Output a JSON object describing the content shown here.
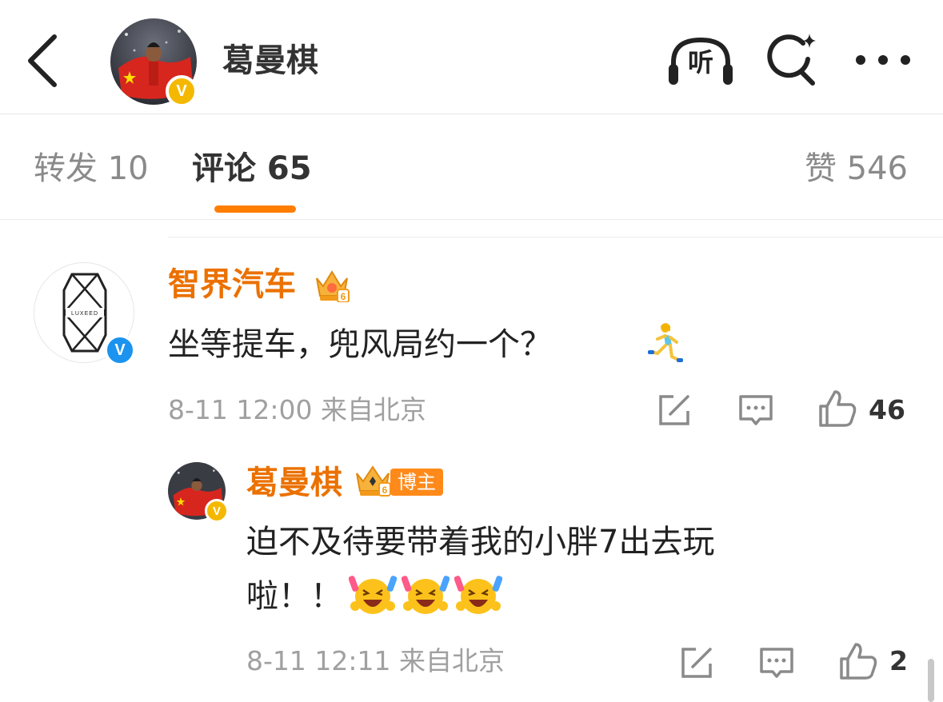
{
  "header": {
    "username": "葛曼棋",
    "listen_label": "听",
    "verified_badge": "V",
    "icons": [
      "back-arrow-icon",
      "headphones-icon",
      "search-sparkle-icon",
      "more-dots-icon"
    ]
  },
  "tabs": {
    "repost": "转发 10",
    "comments": "评论 65",
    "likes": "赞 546",
    "active": "comments",
    "accent_color": "#ff7e00"
  },
  "comments": [
    {
      "username": "智界汽车",
      "verified_badge": "V",
      "verified_color": "#1b93ef",
      "level": "6",
      "text": "坐等提车，兜风局约一个？",
      "emoji": "woman-running-emoji",
      "meta": "8-11 12:00 来自北京",
      "likes": "46",
      "logo_text": "LUXEED"
    }
  ],
  "reply": {
    "username": "葛曼棋",
    "verified_badge": "V",
    "level": "6",
    "badge": "博主",
    "text_line1": "迫不及待要带着我的小胖7出去玩",
    "text_line2": "啦！！",
    "emojis": [
      "laughing-cheer-emoji",
      "laughing-cheer-emoji",
      "laughing-cheer-emoji"
    ],
    "meta": "8-11 12:11 来自北京",
    "likes": "2"
  },
  "colors": {
    "name_orange": "#eb7100",
    "badge_orange": "#ff8a1a",
    "gold_verified": "#f5b800"
  }
}
